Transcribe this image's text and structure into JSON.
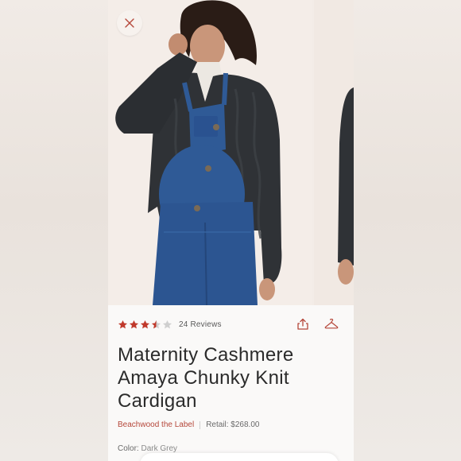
{
  "product": {
    "rating": 3.5,
    "rating_max": 5,
    "reviews_label": "24 Reviews",
    "title": "Maternity Cashmere Amaya Chunky Knit Cardigan",
    "brand": "Beachwood the Label",
    "retail": "Retail: $268.00",
    "color_label": "Color:",
    "color_value": "Dark Grey"
  },
  "colors": {
    "star_fill": "#c0392b",
    "star_empty": "#cfcfcf",
    "brand": "#b5473a",
    "icon_accent": "#b5473a"
  },
  "icons": {
    "close": "close-icon",
    "share": "share-icon",
    "closet": "hanger-icon"
  }
}
